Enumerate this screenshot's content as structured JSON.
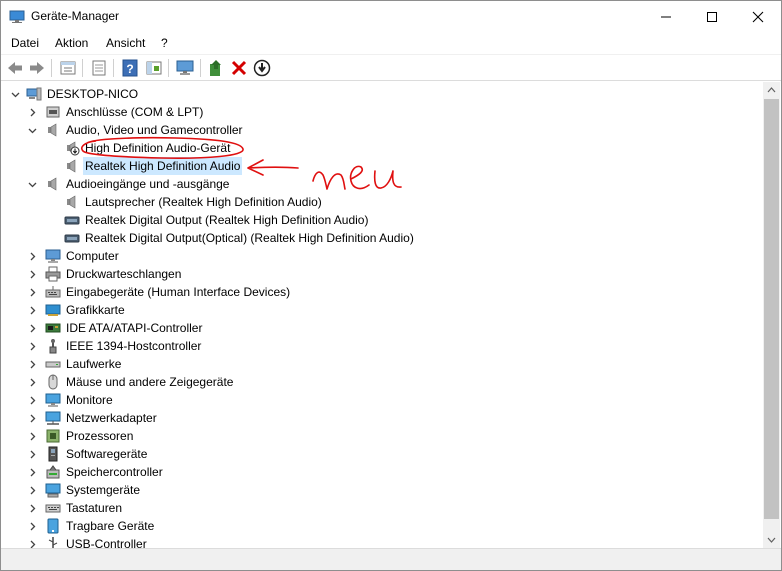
{
  "window": {
    "title": "Geräte-Manager"
  },
  "menu": {
    "items": [
      "Datei",
      "Aktion",
      "Ansicht",
      "?"
    ]
  },
  "toolbar": {
    "buttons": [
      "back-icon",
      "forward-icon",
      "properties-view-icon",
      "print-icon",
      "help-icon",
      "console-tree-icon",
      "scan-hardware-icon",
      "update-driver-icon",
      "uninstall-icon",
      "disable-icon"
    ]
  },
  "tree": {
    "root": "DESKTOP-NICO",
    "items": [
      {
        "label": "Anschlüsse (COM & LPT)",
        "icon": "port-icon"
      },
      {
        "label": "Audio, Video und Gamecontroller",
        "icon": "speaker-icon"
      },
      {
        "label": "High Definition Audio-Gerät",
        "icon": "speaker-download-icon"
      },
      {
        "label": "Realtek High Definition Audio",
        "icon": "speaker-icon"
      },
      {
        "label": "Audioeingänge und -ausgänge",
        "icon": "speaker-icon"
      },
      {
        "label": "Lautsprecher (Realtek High Definition Audio)",
        "icon": "speaker-icon"
      },
      {
        "label": "Realtek Digital Output (Realtek High Definition Audio)",
        "icon": "digital-output-icon"
      },
      {
        "label": "Realtek Digital Output(Optical) (Realtek High Definition Audio)",
        "icon": "digital-output-icon"
      },
      {
        "label": "Computer",
        "icon": "computer-icon"
      },
      {
        "label": "Druckwarteschlangen",
        "icon": "printer-icon"
      },
      {
        "label": "Eingabegeräte (Human Interface Devices)",
        "icon": "hid-icon"
      },
      {
        "label": "Grafikkarte",
        "icon": "graphics-card-icon"
      },
      {
        "label": "IDE ATA/ATAPI-Controller",
        "icon": "ide-controller-icon"
      },
      {
        "label": "IEEE 1394-Hostcontroller",
        "icon": "ieee1394-icon"
      },
      {
        "label": "Laufwerke",
        "icon": "drive-icon"
      },
      {
        "label": "Mäuse und andere Zeigegeräte",
        "icon": "mouse-icon"
      },
      {
        "label": "Monitore",
        "icon": "monitor-icon"
      },
      {
        "label": "Netzwerkadapter",
        "icon": "network-adapter-icon"
      },
      {
        "label": "Prozessoren",
        "icon": "processor-icon"
      },
      {
        "label": "Softwaregeräte",
        "icon": "software-device-icon"
      },
      {
        "label": "Speichercontroller",
        "icon": "storage-controller-icon"
      },
      {
        "label": "Systemgeräte",
        "icon": "system-devices-icon"
      },
      {
        "label": "Tastaturen",
        "icon": "keyboard-icon"
      },
      {
        "label": "Tragbare Geräte",
        "icon": "portable-device-icon"
      },
      {
        "label": "USB-Controller",
        "icon": "usb-icon"
      }
    ]
  },
  "annotation": {
    "text": "neu",
    "color": "#e01010"
  },
  "colors": {
    "selection": "#cce8ff",
    "close_red": "#e81123",
    "uninstall_red": "#d40000"
  }
}
